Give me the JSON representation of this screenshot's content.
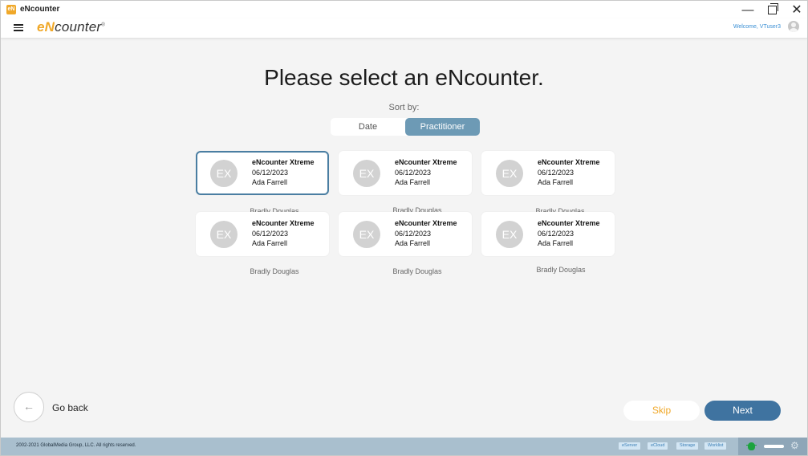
{
  "window": {
    "title": "eNcounter",
    "app_icon": "eN",
    "controls": {
      "minimize": "—",
      "close": "✕"
    }
  },
  "header": {
    "logo_prefix": "e",
    "logo_n": "N",
    "logo_rest": "counter",
    "logo_mark": "®",
    "welcome": "Welcome, VTuser3"
  },
  "main": {
    "title": "Please select an eNcounter.",
    "sort_label": "Sort by:",
    "sort_options": [
      "Date",
      "Practitioner"
    ],
    "sort_selected": "Practitioner"
  },
  "cards": [
    {
      "initials": "EX",
      "name": "eNcounter Xtreme",
      "date": "06/12/2023",
      "person": "Ada Farrell",
      "below": "Bradly Douglas",
      "selected": true
    },
    {
      "initials": "EX",
      "name": "eNcounter Xtreme",
      "date": "06/12/2023",
      "person": "Ada Farrell",
      "below": "Bradly Douglas",
      "selected": false
    },
    {
      "initials": "EX",
      "name": "eNcounter Xtreme",
      "date": "06/12/2023",
      "person": "Ada Farrell",
      "below": "Bradly Douglas",
      "selected": false
    },
    {
      "initials": "EX",
      "name": "eNcounter Xtreme",
      "date": "06/12/2023",
      "person": "Ada Farrell",
      "below": "Bradly Douglas",
      "selected": false
    },
    {
      "initials": "EX",
      "name": "eNcounter Xtreme",
      "date": "06/12/2023",
      "person": "Ada Farrell",
      "below": "Bradly Douglas",
      "selected": false
    },
    {
      "initials": "EX",
      "name": "eNcounter Xtreme",
      "date": "06/12/2023",
      "person": "Ada Farrell",
      "below": "Bradly Douglas",
      "selected": false
    }
  ],
  "actions": {
    "back_arrow": "←",
    "go_back": "Go back",
    "skip": "Skip",
    "next": "Next"
  },
  "footer": {
    "copyright": "2002-2021 GlobalMedia Group, LLC. All rights reserved.",
    "status_items": [
      "eServer",
      "eCloud",
      "Storage",
      "Worklist"
    ],
    "gear": "⚙"
  },
  "colors": {
    "accent_orange": "#f0a829",
    "primary_blue": "#3f73a0",
    "toggle_selected": "#6d9ab5",
    "footer_bg": "#a9bfce",
    "status_green": "#1ca33e"
  },
  "icons": {
    "menu": "hamburger-menu-icon",
    "avatar": "user-avatar-icon",
    "back": "arrow-left-icon",
    "bug": "bug-icon",
    "gear": "gear-icon"
  }
}
